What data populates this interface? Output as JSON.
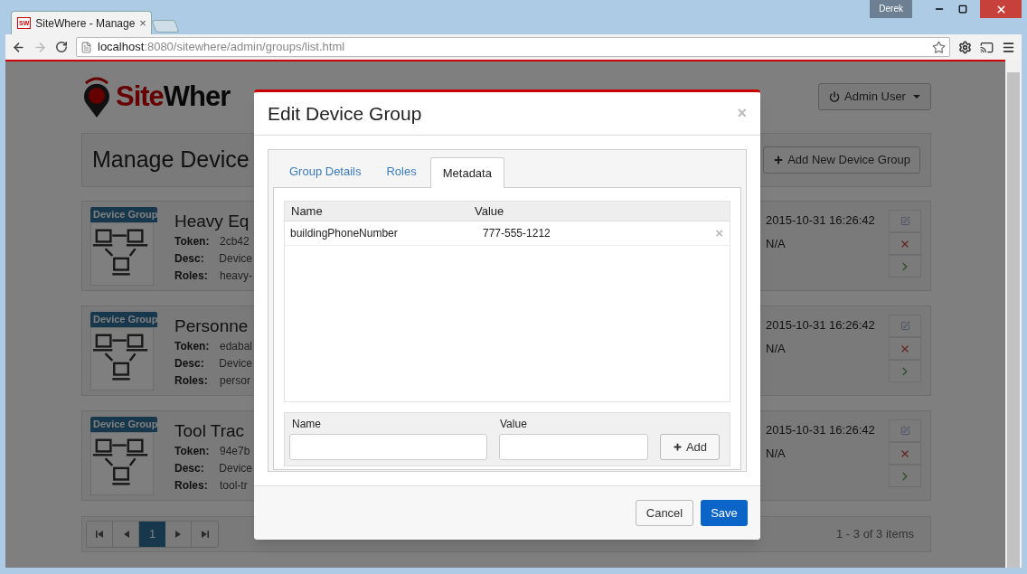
{
  "browser": {
    "favicon": "SW",
    "tab_title": "SiteWhere - Manage",
    "tab_close": "×",
    "user": "Derek",
    "url_host": "localhost",
    "url_path": ":8080/sitewhere/admin/groups/list.html"
  },
  "page": {
    "logo": {
      "red": "Site",
      "dark": "Wher"
    },
    "user_menu": "Admin User",
    "title": "Manage Device",
    "add_button": "Add New Device Group",
    "groups": [
      {
        "badge": "Device Group",
        "name": "Heavy Eq",
        "token_label": "Token:",
        "token": "2cb42",
        "desc_label": "Desc:",
        "desc": "Device",
        "roles_label": "Roles:",
        "roles": "heavy-",
        "created": "2015-10-31 16:26:42",
        "updated": "N/A"
      },
      {
        "badge": "Device Group",
        "name": "Personne",
        "token_label": "Token:",
        "token": "edabal",
        "desc_label": "Desc:",
        "desc": "Device",
        "roles_label": "Roles:",
        "roles": "persor",
        "created": "2015-10-31 16:26:42",
        "updated": "N/A"
      },
      {
        "badge": "Device Group",
        "name": "Tool Trac",
        "token_label": "Token:",
        "token": "94e7b",
        "desc_label": "Desc:",
        "desc": "Device",
        "roles_label": "Roles:",
        "roles": "tool-tr",
        "created": "2015-10-31 16:26:42",
        "updated": "N/A"
      }
    ],
    "pagination": {
      "pages": [
        {
          "label": "1",
          "selected": true
        }
      ],
      "summary": "1 - 3 of 3 items"
    }
  },
  "modal": {
    "title": "Edit Device Group",
    "close": "×",
    "tabs": [
      {
        "label": "Group Details",
        "selected": false
      },
      {
        "label": "Roles",
        "selected": false
      },
      {
        "label": "Metadata",
        "selected": true
      }
    ],
    "table": {
      "columns": [
        "Name",
        "Value"
      ],
      "rows": [
        {
          "name": "buildingPhoneNumber",
          "value": "777-555-1212",
          "delete": "×"
        }
      ]
    },
    "form": {
      "name_label": "Name",
      "value_label": "Value",
      "add_button": "Add"
    },
    "cancel_button": "Cancel",
    "save_button": "Save"
  }
}
